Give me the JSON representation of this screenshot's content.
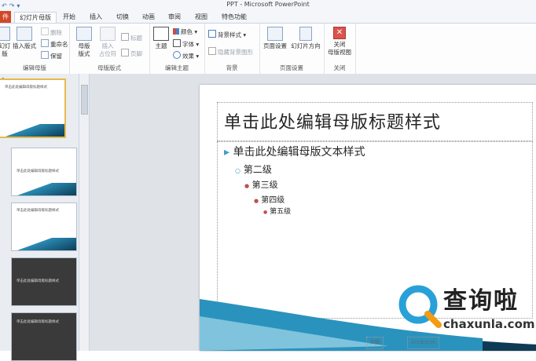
{
  "window": {
    "title": "PPT - Microsoft PowerPoint"
  },
  "tabs": [
    {
      "label": "幻灯片母版"
    },
    {
      "label": "开始"
    },
    {
      "label": "插入"
    },
    {
      "label": "切换"
    },
    {
      "label": "动画"
    },
    {
      "label": "审阅"
    },
    {
      "label": "视图"
    },
    {
      "label": "特色功能"
    }
  ],
  "file_tab": "件",
  "ribbon": {
    "edit_master": {
      "label": "编辑母版",
      "insert_slide": "幻灯\n版",
      "insert_layout": "插入版式",
      "delete": "删除",
      "rename": "重命名",
      "preserve": "保留"
    },
    "master_layout": {
      "label": "母版版式",
      "master_layout_btn": "母版\n版式",
      "insert_placeholder": "插入\n占位符",
      "title_check": "标题",
      "footer_check": "页脚"
    },
    "edit_theme": {
      "label": "编辑主题",
      "theme": "主题",
      "colors": "颜色",
      "fonts": "字体",
      "effects": "效果"
    },
    "background": {
      "label": "背景",
      "bg_styles": "背景样式",
      "hide_bg": "隐藏背景图形"
    },
    "page_setup": {
      "label": "页面设置",
      "page_setup_btn": "页面设置",
      "orientation": "幻灯片方向"
    },
    "close": {
      "label": "关闭",
      "close_master": "关闭\n母版视图"
    }
  },
  "thumbnails": [
    {
      "num": "1",
      "title": "单击此处编辑母版标题样式",
      "selected": true
    },
    {
      "num": "",
      "title": "单击此处编辑母版标题样式"
    },
    {
      "num": "",
      "title": "单击此处编辑母版标题样式"
    },
    {
      "num": "",
      "title": "单击此处编辑母版标题样式",
      "dark": true
    },
    {
      "num": "",
      "title": "单击此处编辑母版标题样式",
      "dark": true
    }
  ],
  "slide": {
    "title": "单击此处编辑母版标题样式",
    "levels": [
      "单击此处编辑母版文本样式",
      "第二级",
      "第三级",
      "第四级",
      "第五级"
    ],
    "footer_date": "2018/3/16",
    "footer_page": "页脚"
  },
  "watermark": {
    "text": "查询啦",
    "url": "chaxunla.com"
  },
  "colors": {
    "accent": "#3aa0c8",
    "file_tab": "#d24726",
    "selection": "#e9b949"
  }
}
